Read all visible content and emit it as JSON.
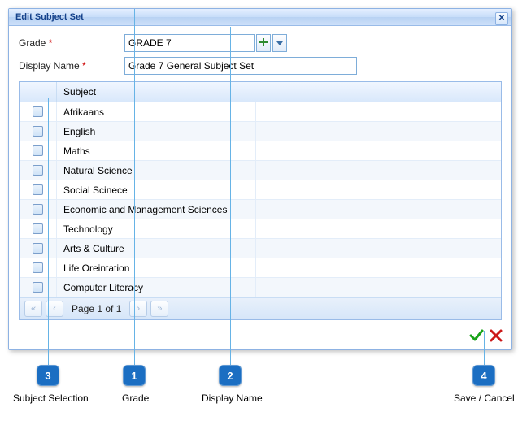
{
  "dialog": {
    "title": "Edit Subject Set",
    "close_tooltip": "Close"
  },
  "form": {
    "grade_label": "Grade",
    "grade_value": "GRADE 7",
    "display_name_label": "Display Name",
    "display_name_value": "Grade 7 General Subject Set"
  },
  "grid": {
    "header_subject": "Subject",
    "rows": [
      "Afrikaans",
      "English",
      "Maths",
      "Natural Science",
      "Social Scinece",
      "Economic and Management Sciences",
      "Technology",
      "Arts & Culture",
      "Life Oreintation",
      "Computer Literacy"
    ]
  },
  "pager": {
    "text": "Page 1 of 1",
    "first": "«",
    "prev": "‹",
    "next": "›",
    "last": "»"
  },
  "actions": {
    "ok": "Save",
    "cancel": "Cancel"
  },
  "annotations": {
    "a1": "Grade",
    "a2": "Display Name",
    "a3": "Subject Selection",
    "a4": "Save / Cancel",
    "n1": "1",
    "n2": "2",
    "n3": "3",
    "n4": "4"
  }
}
